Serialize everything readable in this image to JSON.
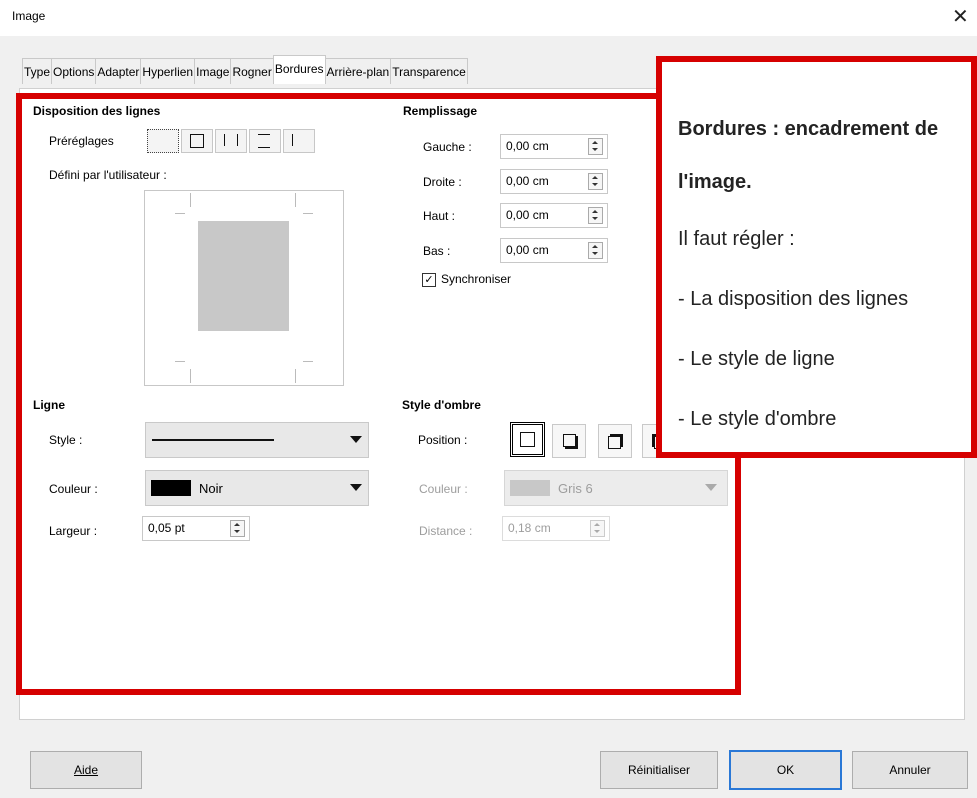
{
  "window": {
    "title": "Image",
    "close_icon": "close-icon"
  },
  "tabs": [
    "Type",
    "Options",
    "Adapter",
    "Hyperlien",
    "Image",
    "Rogner",
    "Bordures",
    "Arrière-plan",
    "Transparence"
  ],
  "active_tab": "Bordures",
  "line_arrangement": {
    "title": "Disposition des lignes",
    "presets_label": "Préréglages",
    "user_defined_label": "Défini par l'utilisateur :"
  },
  "padding": {
    "title": "Remplissage",
    "left_label": "Gauche :",
    "left_value": "0,00 cm",
    "right_label": "Droite :",
    "right_value": "0,00 cm",
    "top_label": "Haut :",
    "top_value": "0,00 cm",
    "bottom_label": "Bas :",
    "bottom_value": "0,00 cm",
    "sync_label": "Synchroniser",
    "sync_checked": true
  },
  "line": {
    "title": "Ligne",
    "style_label": "Style :",
    "color_label": "Couleur :",
    "color_value": "Noir",
    "color_swatch": "#000000",
    "width_label": "Largeur :",
    "width_value": "0,05 pt"
  },
  "shadow": {
    "title": "Style d'ombre",
    "position_label": "Position :",
    "color_label": "Couleur :",
    "color_value": "Gris 6",
    "color_swatch": "#c8c8c8",
    "distance_label": "Distance :",
    "distance_value": "0,18 cm"
  },
  "overlay": {
    "line1": "Bordures : encadrement de",
    "line2": "l'image.",
    "line3": "Il faut régler :",
    "line4": "- La disposition des lignes",
    "line5": "- Le style de ligne",
    "line6": "- Le style d'ombre",
    "accent": "#d60000"
  },
  "footer": {
    "help": "Aide",
    "reset": "Réinitialiser",
    "ok": "OK",
    "cancel": "Annuler"
  }
}
